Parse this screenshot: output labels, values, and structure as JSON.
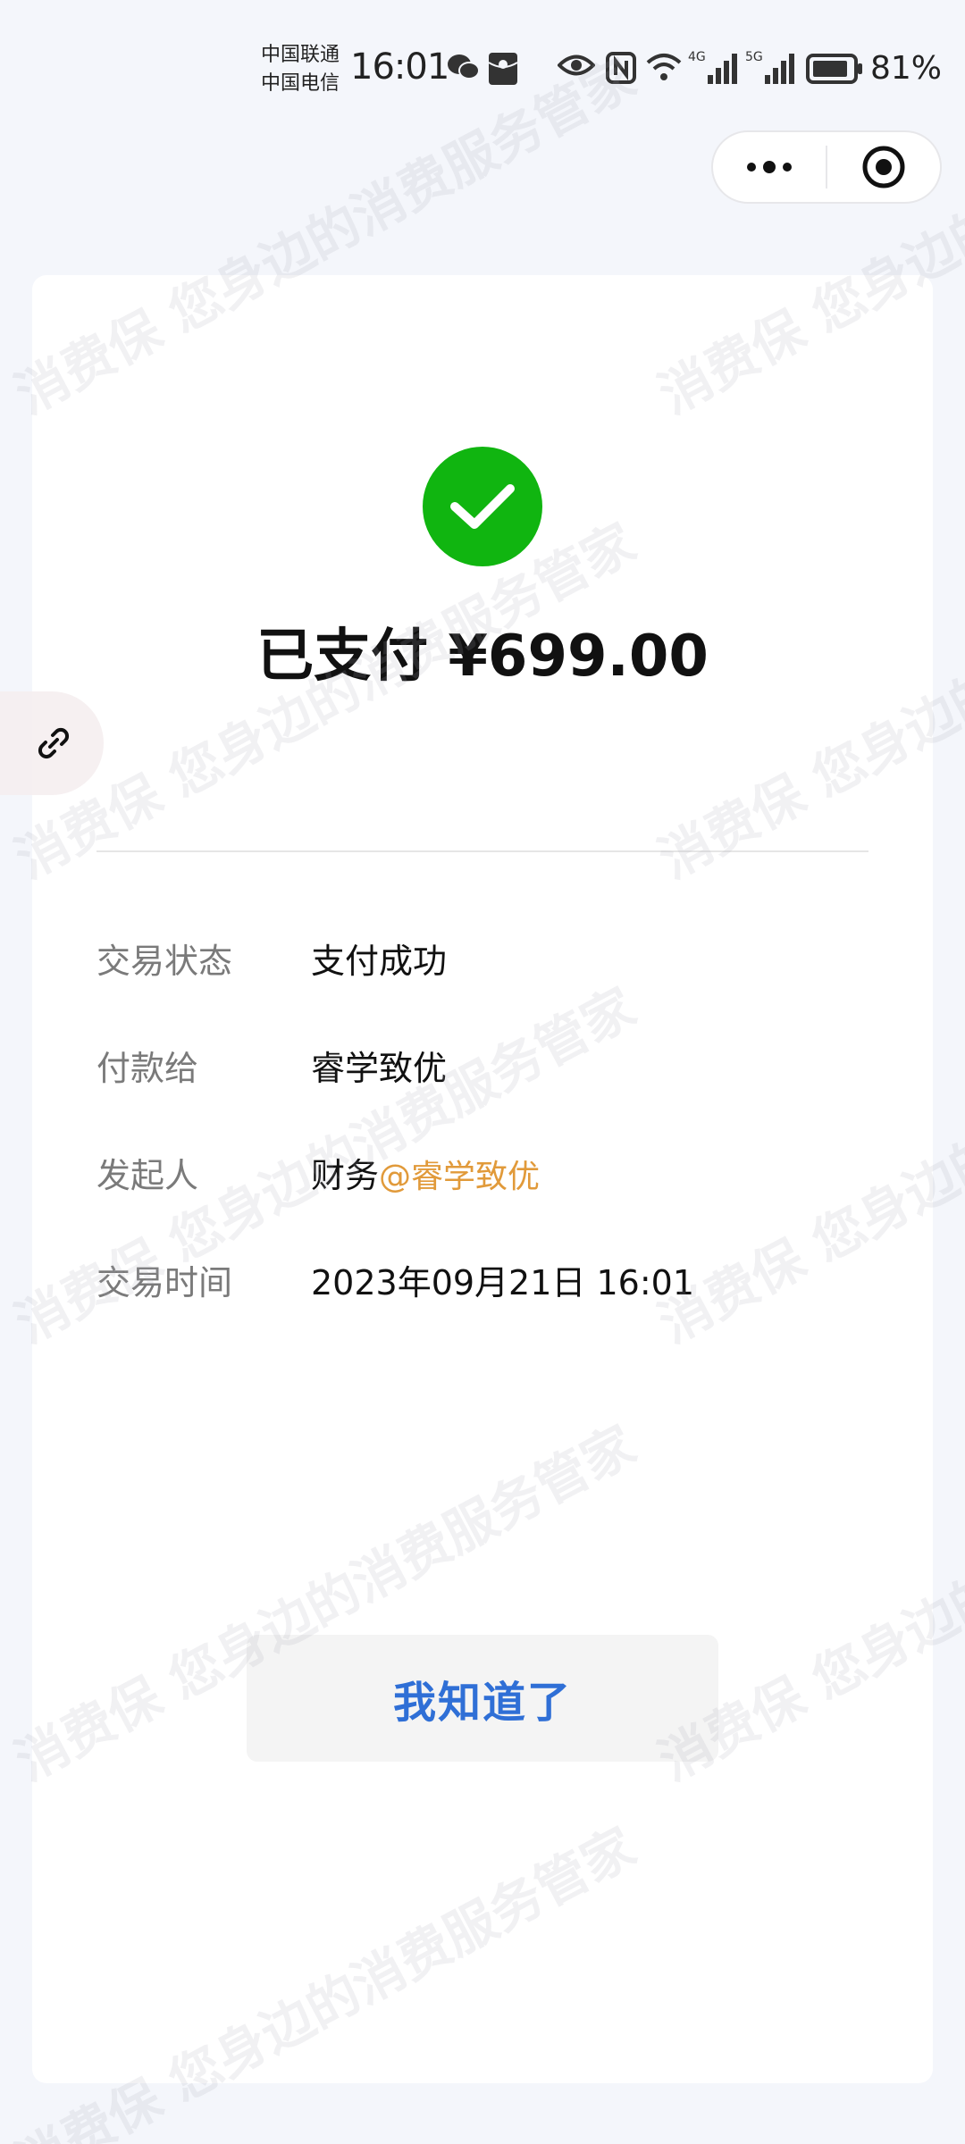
{
  "status_bar": {
    "carrier_1": "中国联通",
    "carrier_2": "中国电信",
    "time": "16:01",
    "network_1": "4G",
    "network_2": "5G",
    "battery_percent": "81%"
  },
  "payment": {
    "title": "已支付 ¥699.00",
    "status_label": "交易状态",
    "status_value": "支付成功",
    "payee_label": "付款给",
    "payee_value": "睿学致优",
    "initiator_label": "发起人",
    "initiator_name": "财务",
    "initiator_mention": "@睿学致优",
    "time_label": "交易时间",
    "time_value": "2023年09月21日 16:01"
  },
  "actions": {
    "confirm_label": "我知道了"
  },
  "watermark": {
    "line_1": "消费保 您身边的消费服务管家"
  },
  "colors": {
    "success_green": "#10b510",
    "link_blue": "#2f6fd6",
    "mention_orange": "#e19a3a"
  }
}
